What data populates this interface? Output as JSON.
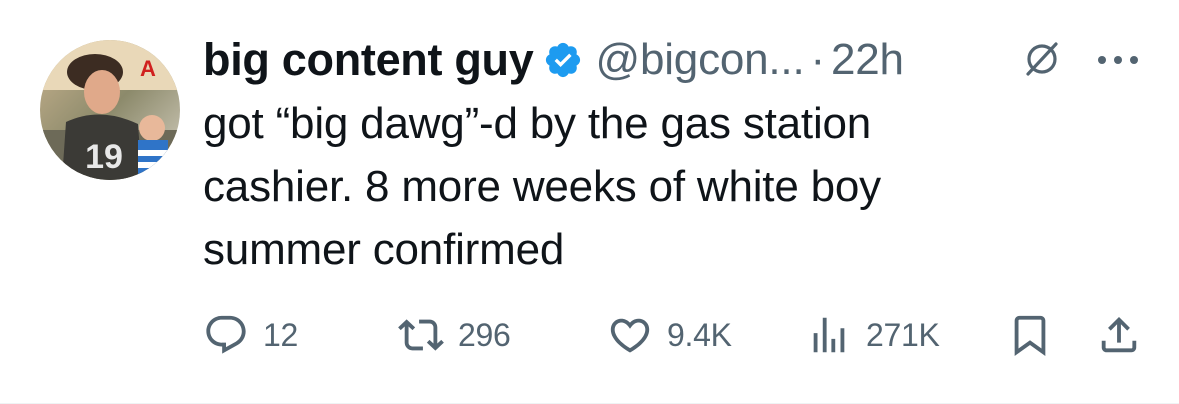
{
  "tweet": {
    "author": {
      "display_name": "big content guy",
      "handle": "@bigcon...",
      "verified": true,
      "avatar_icon": "profile-photo"
    },
    "separator": "·",
    "time": "22h",
    "grok_icon": "grok-icon",
    "more_icon": "more-horizontal-icon",
    "text_lines": [
      "got “big dawg”-d by the gas station",
      "cashier. 8 more weeks of white boy",
      "summer confirmed"
    ],
    "actions": {
      "reply": {
        "icon": "reply-icon",
        "count": "12"
      },
      "retweet": {
        "icon": "retweet-icon",
        "count": "296"
      },
      "like": {
        "icon": "heart-icon",
        "count": "9.4K"
      },
      "views": {
        "icon": "views-icon",
        "count": "271K"
      },
      "bookmark": {
        "icon": "bookmark-icon"
      },
      "share": {
        "icon": "share-icon"
      }
    }
  },
  "colors": {
    "text_primary": "#0f1419",
    "text_secondary": "#536471",
    "verified_blue": "#1d9bf0"
  }
}
